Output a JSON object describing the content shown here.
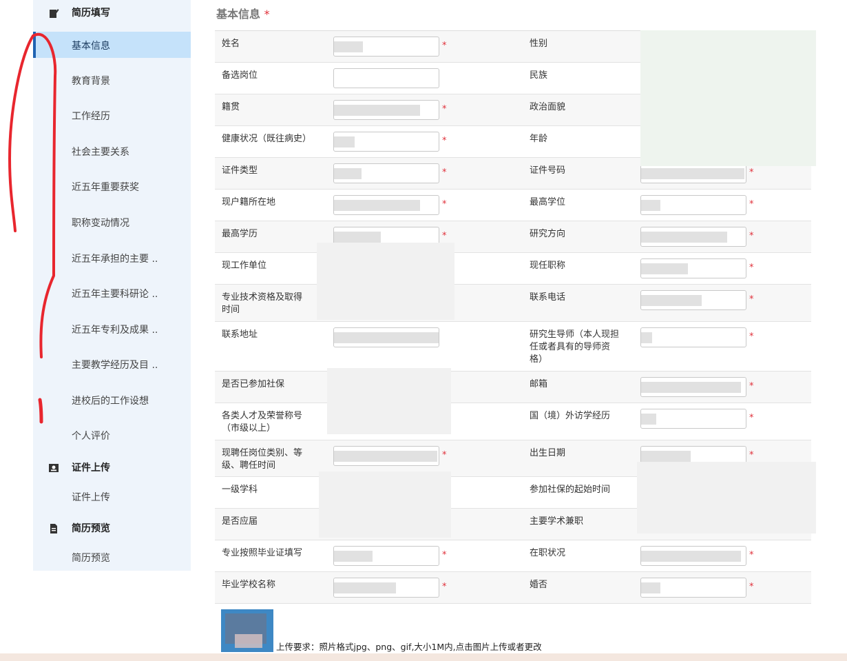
{
  "sidebar": {
    "sections": [
      {
        "title": "简历填写",
        "icon": "edit-icon"
      },
      {
        "title": "证件上传",
        "icon": "id-card-icon"
      },
      {
        "title": "简历预览",
        "icon": "document-icon"
      }
    ],
    "items": [
      {
        "label": "基本信息"
      },
      {
        "label": "教育背景"
      },
      {
        "label": "工作经历"
      },
      {
        "label": "社会主要关系"
      },
      {
        "label": "近五年重要获奖"
      },
      {
        "label": "职称变动情况"
      },
      {
        "label": "近五年承担的主要 .."
      },
      {
        "label": "近五年主要科研论 .."
      },
      {
        "label": "近五年专利及成果 .."
      },
      {
        "label": "主要教学经历及目 .."
      },
      {
        "label": "进校后的工作设想"
      },
      {
        "label": "个人评价"
      },
      {
        "label": "证件上传"
      },
      {
        "label": "简历预览"
      }
    ]
  },
  "form": {
    "title": "基本信息",
    "required_mark": "*",
    "rows": [
      {
        "left": "姓名",
        "right": "性别"
      },
      {
        "left": "备选岗位",
        "right": "民族"
      },
      {
        "left": "籍贯",
        "right": "政治面貌"
      },
      {
        "left": "健康状况（既往病史）",
        "right": "年龄"
      },
      {
        "left": "证件类型",
        "right": "证件号码"
      },
      {
        "left": "现户籍所在地",
        "right": "最高学位"
      },
      {
        "left": "最高学历",
        "right": "研究方向"
      },
      {
        "left": "现工作单位",
        "right": "现任职称"
      },
      {
        "left": "专业技术资格及取得时间",
        "right": "联系电话"
      },
      {
        "left": "联系地址",
        "right": "研究生导师（本人现担任或者具有的导师资格）"
      },
      {
        "left": "是否已参加社保",
        "right": "邮箱"
      },
      {
        "left": "各类人才及荣誉称号（市级以上）",
        "right": "国（境）外访学经历"
      },
      {
        "left": "现聘任岗位类别、等级、聘任时间",
        "right": "出生日期"
      },
      {
        "left": "一级学科",
        "right": "参加社保的起始时间"
      },
      {
        "left": "是否应届",
        "right": "主要学术兼职"
      },
      {
        "left": "专业按照毕业证填写",
        "right": "在职状况"
      },
      {
        "left": "毕业学校名称",
        "right": "婚否"
      }
    ]
  },
  "upload": {
    "note": "上传要求：照片格式jpg、png、gif,大小1M内,点击图片上传或者更改"
  },
  "colors": {
    "sidebar_bg": "#eef4fb",
    "active_bg": "#c5e2fa",
    "active_bar": "#1f63b2",
    "required": "#e0303a",
    "annotation": "#e8262e"
  }
}
